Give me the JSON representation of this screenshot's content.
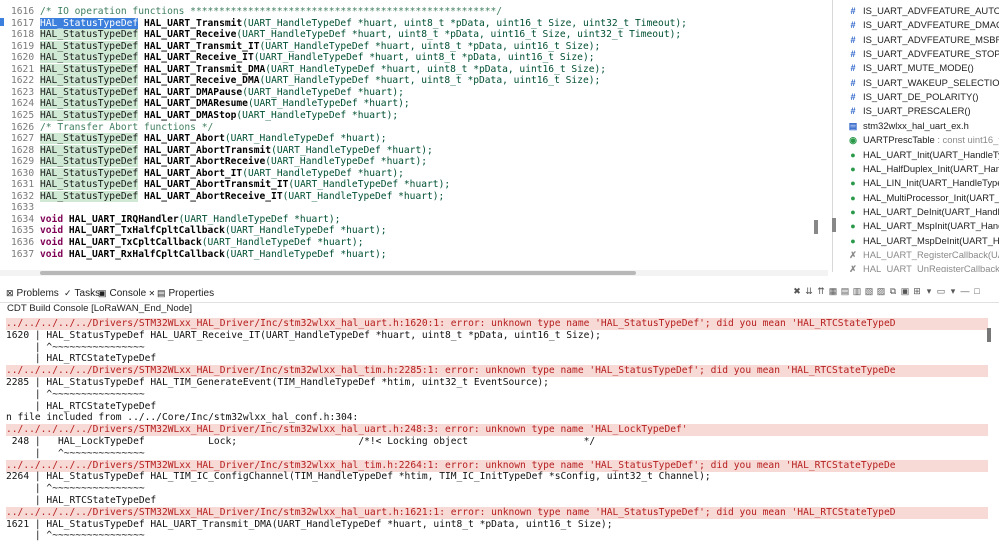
{
  "editor": {
    "lines": [
      {
        "n": "1616",
        "kind": "comment",
        "text": "/* IO operation functions *****************************************************/"
      },
      {
        "n": "1617",
        "kind": "decl",
        "selected": true,
        "type": "HAL_StatusTypeDef",
        "fn": "HAL_UART_Transmit",
        "args": "(UART_HandleTypeDef *huart, uint8_t *pData, uint16_t Size, uint32_t Timeout);"
      },
      {
        "n": "1618",
        "kind": "decl",
        "type": "HAL_StatusTypeDef",
        "fn": "HAL_UART_Receive",
        "args": "(UART_HandleTypeDef *huart, uint8_t *pData, uint16_t Size, uint32_t Timeout);"
      },
      {
        "n": "1619",
        "kind": "decl",
        "type": "HAL_StatusTypeDef",
        "fn": "HAL_UART_Transmit_IT",
        "args": "(UART_HandleTypeDef *huart, uint8_t *pData, uint16_t Size);"
      },
      {
        "n": "1620",
        "kind": "decl",
        "type": "HAL_StatusTypeDef",
        "fn": "HAL_UART_Receive_IT",
        "args": "(UART_HandleTypeDef *huart, uint8_t *pData, uint16_t Size);"
      },
      {
        "n": "1621",
        "kind": "decl",
        "type": "HAL_StatusTypeDef",
        "fn": "HAL_UART_Transmit_DMA",
        "args": "(UART_HandleTypeDef *huart, uint8_t *pData, uint16_t Size);"
      },
      {
        "n": "1622",
        "kind": "decl",
        "type": "HAL_StatusTypeDef",
        "fn": "HAL_UART_Receive_DMA",
        "args": "(UART_HandleTypeDef *huart, uint8_t *pData, uint16_t Size);"
      },
      {
        "n": "1623",
        "kind": "decl",
        "type": "HAL_StatusTypeDef",
        "fn": "HAL_UART_DMAPause",
        "args": "(UART_HandleTypeDef *huart);"
      },
      {
        "n": "1624",
        "kind": "decl",
        "type": "HAL_StatusTypeDef",
        "fn": "HAL_UART_DMAResume",
        "args": "(UART_HandleTypeDef *huart);"
      },
      {
        "n": "1625",
        "kind": "decl",
        "type": "HAL_StatusTypeDef",
        "fn": "HAL_UART_DMAStop",
        "args": "(UART_HandleTypeDef *huart);"
      },
      {
        "n": "1626",
        "kind": "comment",
        "text": "/* Transfer Abort functions */"
      },
      {
        "n": "1627",
        "kind": "decl",
        "type": "HAL_StatusTypeDef",
        "fn": "HAL_UART_Abort",
        "args": "(UART_HandleTypeDef *huart);"
      },
      {
        "n": "1628",
        "kind": "decl",
        "type": "HAL_StatusTypeDef",
        "fn": "HAL_UART_AbortTransmit",
        "args": "(UART_HandleTypeDef *huart);"
      },
      {
        "n": "1629",
        "kind": "decl",
        "type": "HAL_StatusTypeDef",
        "fn": "HAL_UART_AbortReceive",
        "args": "(UART_HandleTypeDef *huart);"
      },
      {
        "n": "1630",
        "kind": "decl",
        "type": "HAL_StatusTypeDef",
        "fn": "HAL_UART_Abort_IT",
        "args": "(UART_HandleTypeDef *huart);"
      },
      {
        "n": "1631",
        "kind": "decl",
        "type": "HAL_StatusTypeDef",
        "fn": "HAL_UART_AbortTransmit_IT",
        "args": "(UART_HandleTypeDef *huart);"
      },
      {
        "n": "1632",
        "kind": "decl",
        "type": "HAL_StatusTypeDef",
        "fn": "HAL_UART_AbortReceive_IT",
        "args": "(UART_HandleTypeDef *huart);"
      },
      {
        "n": "1633",
        "kind": "blank",
        "text": ""
      },
      {
        "n": "1634",
        "kind": "void",
        "type": "void",
        "fn": "HAL_UART_IRQHandler",
        "args": "(UART_HandleTypeDef *huart);"
      },
      {
        "n": "1635",
        "kind": "void",
        "type": "void",
        "fn": "HAL_UART_TxHalfCpltCallback",
        "args": "(UART_HandleTypeDef *huart);"
      },
      {
        "n": "1636",
        "kind": "void",
        "type": "void",
        "fn": "HAL_UART_TxCpltCallback",
        "args": "(UART_HandleTypeDef *huart);"
      },
      {
        "n": "1637",
        "kind": "void",
        "type": "void",
        "fn": "HAL_UART_RxHalfCpltCallback",
        "args": "(UART_HandleTypeDef *huart);"
      }
    ]
  },
  "outline": {
    "items": [
      {
        "icon": "#",
        "cls": "",
        "text": "IS_UART_ADVFEATURE_AUTOBAUD"
      },
      {
        "icon": "#",
        "cls": "",
        "text": "IS_UART_ADVFEATURE_DMAONRX"
      },
      {
        "icon": "#",
        "cls": "",
        "text": "IS_UART_ADVFEATURE_MSBFIRST("
      },
      {
        "icon": "#",
        "cls": "",
        "text": "IS_UART_ADVFEATURE_STOPMODE"
      },
      {
        "icon": "#",
        "cls": "",
        "text": "IS_UART_MUTE_MODE()"
      },
      {
        "icon": "#",
        "cls": "",
        "text": "IS_UART_WAKEUP_SELECTION()"
      },
      {
        "icon": "#",
        "cls": "",
        "text": "IS_UART_DE_POLARITY()"
      },
      {
        "icon": "#",
        "cls": "",
        "text": "IS_UART_PRESCALER()"
      },
      {
        "icon": "▤",
        "cls": "",
        "text": "stm32wlxx_hal_uart_ex.h"
      },
      {
        "icon": "◉",
        "cls": "green",
        "text": "UARTPrescTable",
        "type": " : const uint16_t[]"
      },
      {
        "icon": "●",
        "cls": "green",
        "text": "HAL_UART_Init(UART_HandleTypeD"
      },
      {
        "icon": "●",
        "cls": "green",
        "text": "HAL_HalfDuplex_Init(UART_Handle"
      },
      {
        "icon": "●",
        "cls": "green",
        "text": "HAL_LIN_Init(UART_HandleTypeDef"
      },
      {
        "icon": "●",
        "cls": "green",
        "text": "HAL_MultiProcessor_Init(UART_Hand"
      },
      {
        "icon": "●",
        "cls": "green",
        "text": "HAL_UART_DeInit(UART_HandleTy"
      },
      {
        "icon": "●",
        "cls": "green",
        "text": "HAL_UART_MspInit(UART_HandleTy"
      },
      {
        "icon": "●",
        "cls": "green",
        "text": "HAL_UART_MspDeInit(UART_Handl"
      },
      {
        "icon": "✗",
        "cls": "grey",
        "text": "HAL_UART_RegisterCallback(UART_"
      },
      {
        "icon": "✗",
        "cls": "grey",
        "text": "HAL_UART_UnRegisterCallback(UAR"
      }
    ]
  },
  "tabs": [
    {
      "id": "problems",
      "icon": "⊠",
      "label": "Problems"
    },
    {
      "id": "tasks",
      "icon": "✓",
      "label": "Tasks"
    },
    {
      "id": "console",
      "icon": "▣",
      "label": "Console",
      "close": "✕"
    },
    {
      "id": "properties",
      "icon": "▤",
      "label": "Properties"
    }
  ],
  "console_title": "CDT Build Console [LoRaWAN_End_Node]",
  "console": {
    "lines": [
      {
        "err": true,
        "text": "../../../../../Drivers/STM32WLxx_HAL_Driver/Inc/stm32wlxx_hal_uart.h:1620:1: error: unknown type name 'HAL_StatusTypeDef'; did you mean 'HAL_RTCStateTypeD"
      },
      {
        "err": false,
        "text": "1620 | HAL_StatusTypeDef HAL_UART_Receive_IT(UART_HandleTypeDef *huart, uint8_t *pData, uint16_t Size);"
      },
      {
        "err": false,
        "text": "     | ^~~~~~~~~~~~~~~~~"
      },
      {
        "err": false,
        "text": "     | HAL_RTCStateTypeDef"
      },
      {
        "err": true,
        "text": "../../../../../Drivers/STM32WLxx_HAL_Driver/Inc/stm32wlxx_hal_tim.h:2285:1: error: unknown type name 'HAL_StatusTypeDef'; did you mean 'HAL_RTCStateTypeDe"
      },
      {
        "err": false,
        "text": "2285 | HAL_StatusTypeDef HAL_TIM_GenerateEvent(TIM_HandleTypeDef *htim, uint32_t EventSource);"
      },
      {
        "err": false,
        "text": "     | ^~~~~~~~~~~~~~~~~"
      },
      {
        "err": false,
        "text": "     | HAL_RTCStateTypeDef"
      },
      {
        "err": false,
        "text": "n file included from ../../Core/Inc/stm32wlxx_hal_conf.h:304:"
      },
      {
        "err": true,
        "text": "../../../../../Drivers/STM32WLxx_HAL_Driver/Inc/stm32wlxx_hal_uart.h:248:3: error: unknown type name 'HAL_LockTypeDef'"
      },
      {
        "err": false,
        "text": " 248 |   HAL_LockTypeDef           Lock;                     /*!< Locking object                    */"
      },
      {
        "err": false,
        "text": "     |   ^~~~~~~~~~~~~~~"
      },
      {
        "err": true,
        "text": "../../../../../Drivers/STM32WLxx_HAL_Driver/Inc/stm32wlxx_hal_tim.h:2264:1: error: unknown type name 'HAL_StatusTypeDef'; did you mean 'HAL_RTCStateTypeDe"
      },
      {
        "err": false,
        "text": "2264 | HAL_StatusTypeDef HAL_TIM_IC_ConfigChannel(TIM_HandleTypeDef *htim, TIM_IC_InitTypeDef *sConfig, uint32_t Channel);"
      },
      {
        "err": false,
        "text": "     | ^~~~~~~~~~~~~~~~~"
      },
      {
        "err": false,
        "text": "     | HAL_RTCStateTypeDef"
      },
      {
        "err": true,
        "text": "../../../../../Drivers/STM32WLxx_HAL_Driver/Inc/stm32wlxx_hal_uart.h:1621:1: error: unknown type name 'HAL_StatusTypeDef'; did you mean 'HAL_RTCStateTypeD"
      },
      {
        "err": false,
        "text": "1621 | HAL_StatusTypeDef HAL_UART_Transmit_DMA(UART_HandleTypeDef *huart, uint8_t *pData, uint16_t Size);"
      },
      {
        "err": false,
        "text": "     | ^~~~~~~~~~~~~~~~~"
      }
    ]
  },
  "toolbar_icons": [
    "✖",
    "⇊",
    "⇈",
    "▦",
    "▤",
    "▥",
    "▧",
    "▨",
    "⧉",
    "▣",
    "⊞",
    "▾",
    "▭",
    "▾",
    "—",
    "□"
  ]
}
